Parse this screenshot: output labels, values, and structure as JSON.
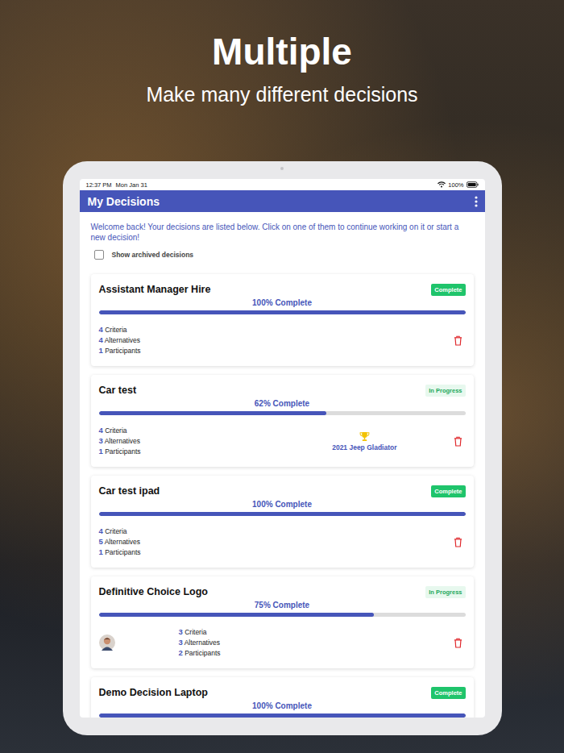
{
  "promo": {
    "headline": "Multiple",
    "subtitle": "Make many different decisions"
  },
  "status_bar": {
    "time": "12:37 PM",
    "date": "Mon Jan 31",
    "battery": "100%"
  },
  "app_bar": {
    "title": "My Decisions"
  },
  "intro": "Welcome back! Your decisions are listed below. Click on one of them to continue working on it or start a new decision!",
  "archived_toggle": {
    "label": "Show archived decisions",
    "checked": false
  },
  "stat_labels": {
    "criteria": "Criteria",
    "alternatives": "Alternatives",
    "participants": "Participants"
  },
  "decisions": [
    {
      "title": "Assistant Manager Hire",
      "status": "Complete",
      "complete": true,
      "progress_label": "100% Complete",
      "level": 1.0,
      "criteria": "4",
      "alternatives": "4",
      "participants": "1",
      "winner": null,
      "avatar": false,
      "deletable": true
    },
    {
      "title": "Car test",
      "status": "In Progress",
      "complete": false,
      "progress_label": "62% Complete",
      "level": 0.62,
      "criteria": "4",
      "alternatives": "3",
      "participants": "1",
      "winner": "2021 Jeep Gladiator",
      "avatar": false,
      "deletable": true
    },
    {
      "title": "Car test ipad",
      "status": "Complete",
      "complete": true,
      "progress_label": "100% Complete",
      "level": 1.0,
      "criteria": "4",
      "alternatives": "5",
      "participants": "1",
      "winner": null,
      "avatar": false,
      "deletable": true
    },
    {
      "title": "Definitive Choice Logo",
      "status": "In Progress",
      "complete": false,
      "progress_label": "75% Complete",
      "level": 0.75,
      "criteria": "3",
      "alternatives": "3",
      "participants": "2",
      "winner": null,
      "avatar": true,
      "deletable": true
    },
    {
      "title": "Demo Decision Laptop",
      "status": "Complete",
      "complete": true,
      "progress_label": "100% Complete",
      "level": 1.0,
      "criteria": null,
      "alternatives": null,
      "participants": null,
      "winner": null,
      "avatar": false,
      "deletable": false
    }
  ]
}
